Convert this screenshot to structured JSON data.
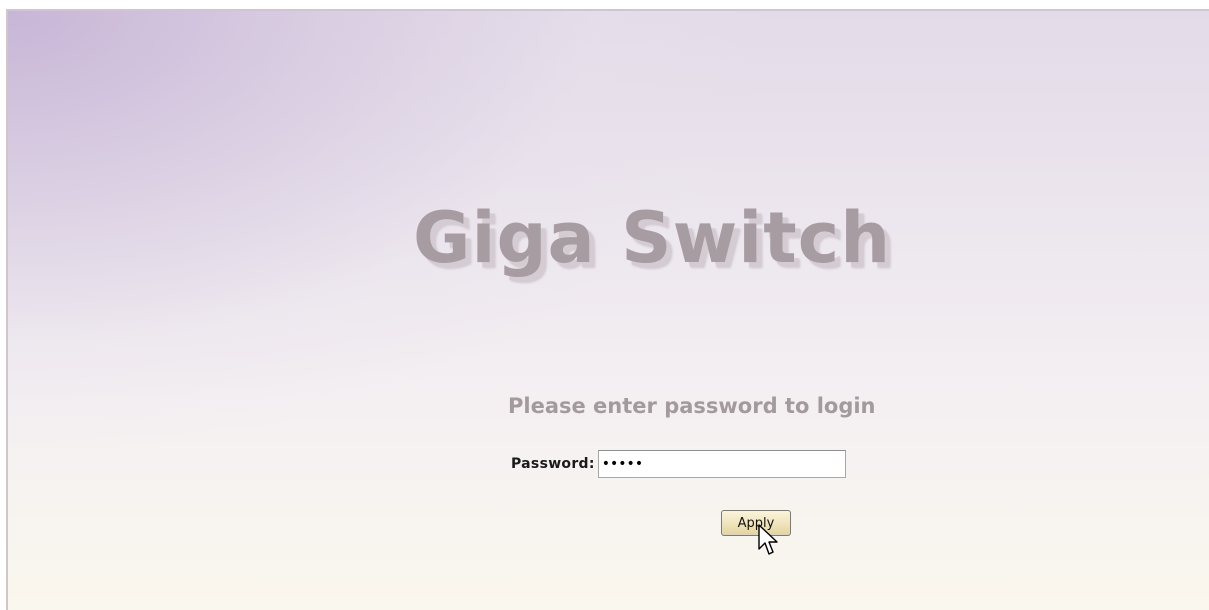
{
  "login": {
    "brand_title": "Giga Switch",
    "prompt": "Please enter password to login",
    "password_label": "Password:",
    "password_value": "12345",
    "apply_label": "Apply"
  },
  "icons": {
    "cursor": "arrow-pointer-icon"
  },
  "colors": {
    "title_text": "#a89ca3",
    "prompt_text": "#a39a9e",
    "button_face": "#efe3bb",
    "background_top_left": "#c6b4d6",
    "background_bottom": "#faf7ee"
  }
}
